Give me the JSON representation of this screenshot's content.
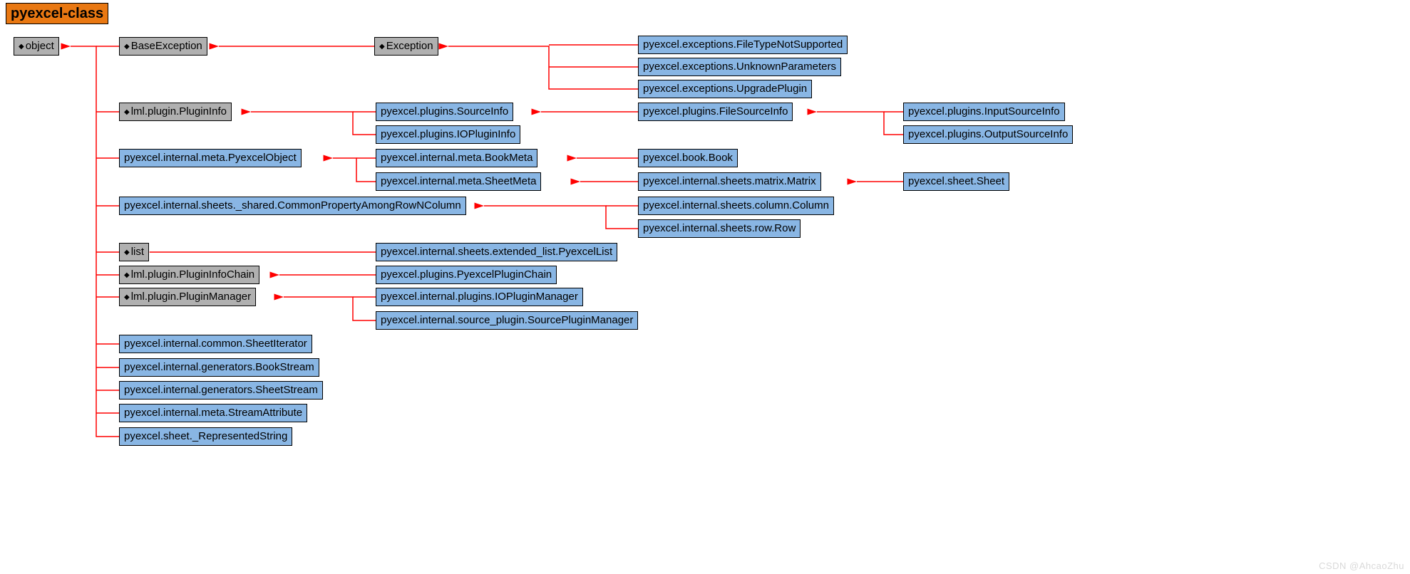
{
  "title": "pyexcel-class",
  "watermark": "CSDN @AhcaoZhu",
  "nodes": {
    "object": "object",
    "base_exc": "BaseException",
    "exc": "Exception",
    "ftns": "pyexcel.exceptions.FileTypeNotSupported",
    "unkp": "pyexcel.exceptions.UnknownParameters",
    "upg": "pyexcel.exceptions.UpgradePlugin",
    "lml_pi": "lml.plugin.PluginInfo",
    "src_info": "pyexcel.plugins.SourceInfo",
    "iop_info": "pyexcel.plugins.IOPluginInfo",
    "fsrc_info": "pyexcel.plugins.FileSourceInfo",
    "in_src": "pyexcel.plugins.InputSourceInfo",
    "out_src": "pyexcel.plugins.OutputSourceInfo",
    "pyobj": "pyexcel.internal.meta.PyexcelObject",
    "book_meta": "pyexcel.internal.meta.BookMeta",
    "sheet_meta": "pyexcel.internal.meta.SheetMeta",
    "book": "pyexcel.book.Book",
    "matrix": "pyexcel.internal.sheets.matrix.Matrix",
    "sheet": "pyexcel.sheet.Sheet",
    "common_prop": "pyexcel.internal.sheets._shared.CommonPropertyAmongRowNColumn",
    "col": "pyexcel.internal.sheets.column.Column",
    "row": "pyexcel.internal.sheets.row.Row",
    "list": "list",
    "ext_list": "pyexcel.internal.sheets.extended_list.PyexcelList",
    "lml_chain": "lml.plugin.PluginInfoChain",
    "py_chain": "pyexcel.plugins.PyexcelPluginChain",
    "lml_mgr": "lml.plugin.PluginManager",
    "iop_mgr": "pyexcel.internal.plugins.IOPluginManager",
    "src_mgr": "pyexcel.internal.source_plugin.SourcePluginManager",
    "sheet_iter": "pyexcel.internal.common.SheetIterator",
    "book_stream": "pyexcel.internal.generators.BookStream",
    "sheet_stream": "pyexcel.internal.generators.SheetStream",
    "stream_attr": "pyexcel.internal.meta.StreamAttribute",
    "repr_str": "pyexcel.sheet._RepresentedString"
  }
}
